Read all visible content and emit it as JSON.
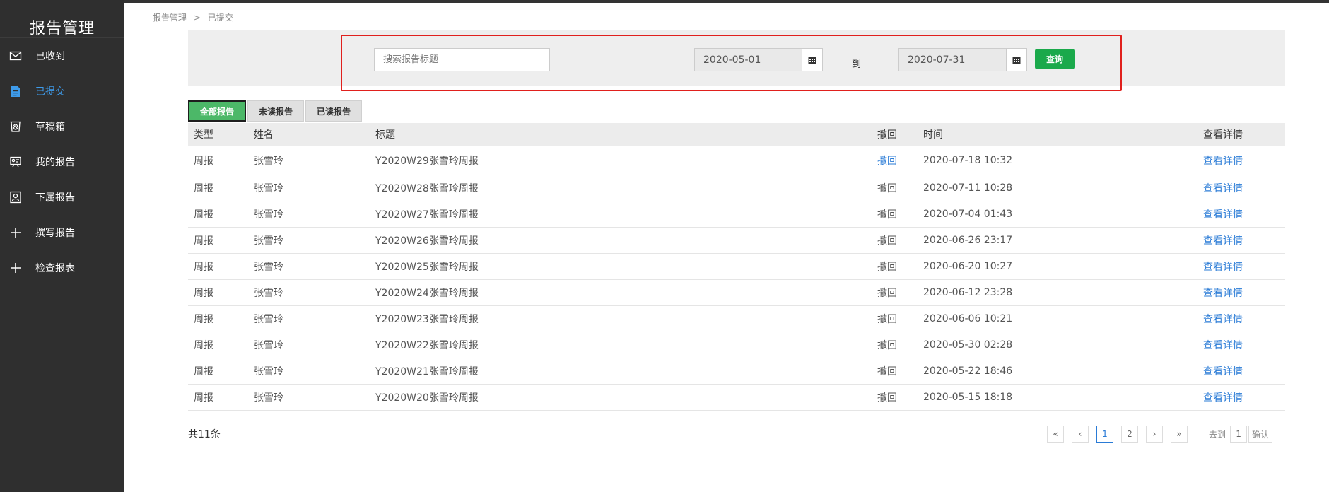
{
  "sidebar": {
    "brand": "报告管理",
    "items": [
      {
        "label": "已收到",
        "icon": "mail-icon"
      },
      {
        "label": "已提交",
        "icon": "document-icon"
      },
      {
        "label": "草稿箱",
        "icon": "draft-box-icon"
      },
      {
        "label": "我的报告",
        "icon": "presentation-icon"
      },
      {
        "label": "下属报告",
        "icon": "contact-card-icon"
      },
      {
        "label": "撰写报告",
        "icon": "plus-icon"
      },
      {
        "label": "检查报表",
        "icon": "plus-icon"
      }
    ],
    "active_index": 1
  },
  "breadcrumb": {
    "root": "报告管理",
    "separator": ">",
    "current": "已提交"
  },
  "filter": {
    "search_placeholder": "搜索报告标题",
    "start_date": "2020-05-01",
    "to_label": "到",
    "end_date": "2020-07-31",
    "query_label": "查询"
  },
  "tabs": [
    {
      "label": "全部报告"
    },
    {
      "label": "未读报告"
    },
    {
      "label": "已读报告"
    }
  ],
  "table": {
    "headers": {
      "type": "类型",
      "name": "姓名",
      "title": "标题",
      "recall": "撤回",
      "time": "时间",
      "detail": "查看详情"
    },
    "rows": [
      {
        "type": "周报",
        "name": "张雪玲",
        "title": "Y2020W29张雪玲周报",
        "recall": "撤回",
        "time": "2020-07-18 10:32",
        "detail": "查看详情"
      },
      {
        "type": "周报",
        "name": "张雪玲",
        "title": "Y2020W28张雪玲周报",
        "recall": "撤回",
        "time": "2020-07-11 10:28",
        "detail": "查看详情"
      },
      {
        "type": "周报",
        "name": "张雪玲",
        "title": "Y2020W27张雪玲周报",
        "recall": "撤回",
        "time": "2020-07-04 01:43",
        "detail": "查看详情"
      },
      {
        "type": "周报",
        "name": "张雪玲",
        "title": "Y2020W26张雪玲周报",
        "recall": "撤回",
        "time": "2020-06-26 23:17",
        "detail": "查看详情"
      },
      {
        "type": "周报",
        "name": "张雪玲",
        "title": "Y2020W25张雪玲周报",
        "recall": "撤回",
        "time": "2020-06-20 10:27",
        "detail": "查看详情"
      },
      {
        "type": "周报",
        "name": "张雪玲",
        "title": "Y2020W24张雪玲周报",
        "recall": "撤回",
        "time": "2020-06-12 23:28",
        "detail": "查看详情"
      },
      {
        "type": "周报",
        "name": "张雪玲",
        "title": "Y2020W23张雪玲周报",
        "recall": "撤回",
        "time": "2020-06-06 10:21",
        "detail": "查看详情"
      },
      {
        "type": "周报",
        "name": "张雪玲",
        "title": "Y2020W22张雪玲周报",
        "recall": "撤回",
        "time": "2020-05-30 02:28",
        "detail": "查看详情"
      },
      {
        "type": "周报",
        "name": "张雪玲",
        "title": "Y2020W21张雪玲周报",
        "recall": "撤回",
        "time": "2020-05-22 18:46",
        "detail": "查看详情"
      },
      {
        "type": "周报",
        "name": "张雪玲",
        "title": "Y2020W20张雪玲周报",
        "recall": "撤回",
        "time": "2020-05-15 18:18",
        "detail": "查看详情"
      }
    ]
  },
  "footer": {
    "total": "共11条",
    "pager": {
      "first": "«",
      "prev": "‹",
      "pages": [
        "1",
        "2"
      ],
      "next": "›",
      "last": "»",
      "goto_label": "去到",
      "goto_value": "1",
      "confirm": "确认"
    }
  },
  "colors": {
    "sidebar_bg": "#2f2f2f",
    "active_link": "#3e9bea",
    "query_button": "#1aa94b",
    "active_tab": "#4cb868",
    "highlight_border": "#e0201d"
  }
}
